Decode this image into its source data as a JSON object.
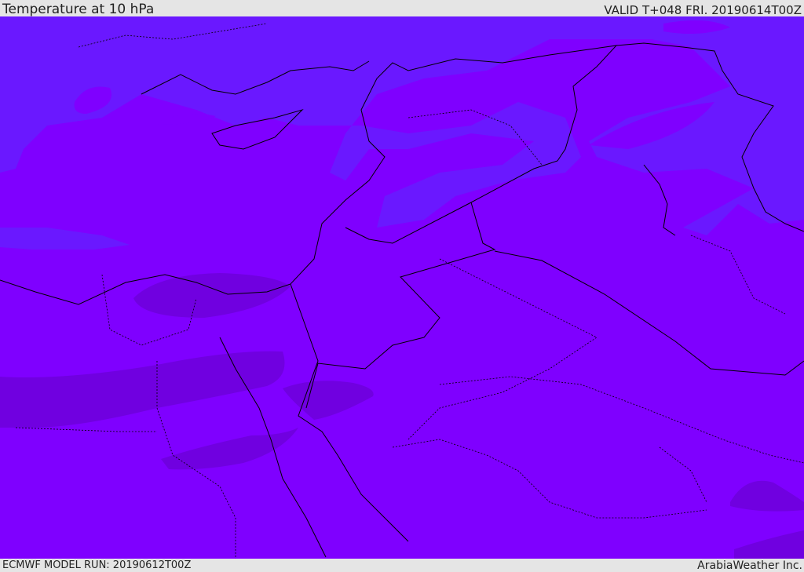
{
  "header": {
    "title": "Temperature at 10 hPa",
    "valid": "VALID T+048 FRI. 20190614T00Z"
  },
  "footer": {
    "model_run": "ECMWF MODEL RUN: 20190612T00Z",
    "brand": "ArabiaWeather Inc."
  },
  "colors": {
    "base": "#7f00ff",
    "cool": "#6a18ff",
    "warm": "#7000e0",
    "border": "#000000"
  }
}
